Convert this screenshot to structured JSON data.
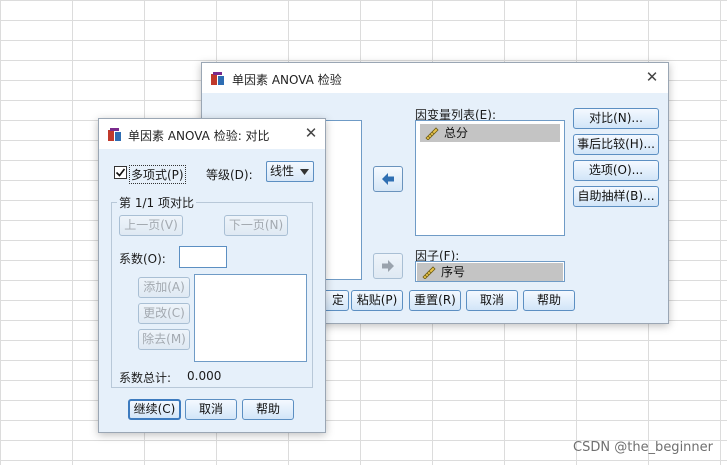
{
  "main_dialog": {
    "title": "单因素 ANOVA 检验",
    "dependent_list_label": "因变量列表(E):",
    "dependent_vars": [
      {
        "name": "总分",
        "icon": "scale-variable-icon"
      }
    ],
    "factor_label": "因子(F):",
    "factor_var": {
      "name": "序号",
      "icon": "scale-variable-icon"
    },
    "side_buttons": [
      "对比(N)...",
      "事后比较(H)...",
      "选项(O)...",
      "自助抽样(B)..."
    ],
    "bottom_buttons": {
      "ok_partial": "定",
      "paste": "粘贴(P)",
      "reset": "重置(R)",
      "cancel": "取消",
      "help": "帮助"
    }
  },
  "contrast_dialog": {
    "title": "单因素 ANOVA 检验: 对比",
    "polynomial_label": "多项式(P)",
    "polynomial_checked": true,
    "degree_label": "等级(D):",
    "degree_value": "线性",
    "group_title": "第 1/1 项对比",
    "prev_button": "上一页(V)",
    "next_button": "下一页(N)",
    "coef_label": "系数(O):",
    "coef_value": "",
    "add_button": "添加(A)",
    "change_button": "更改(C)",
    "remove_button": "除去(M)",
    "total_label": "系数总计:",
    "total_value": "0.000",
    "continue_button": "继续(C)",
    "cancel_button": "取消",
    "help_button": "帮助"
  },
  "watermark": "CSDN @the_beginner",
  "colors": {
    "dialog_bg": "#e6f0fa",
    "button_border": "#5c8fc2",
    "selected_var_bg": "#c4c4c4"
  }
}
